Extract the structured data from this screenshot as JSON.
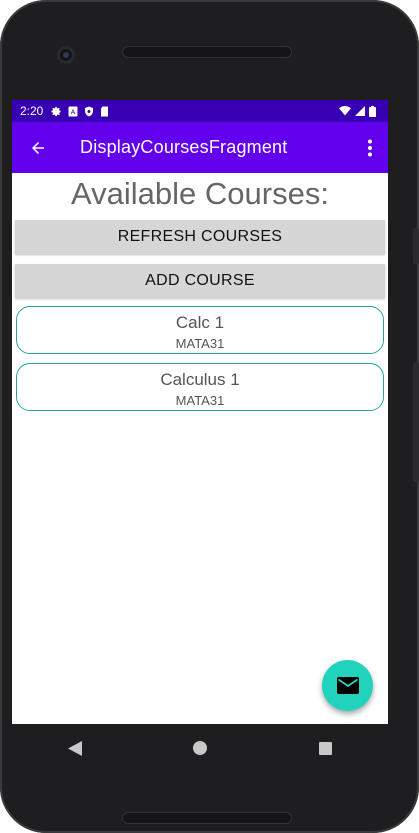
{
  "status_bar": {
    "time": "2:20"
  },
  "app_bar": {
    "title": "DisplayCoursesFragment"
  },
  "content": {
    "heading": "Available Courses:",
    "refresh_button": "REFRESH COURSES",
    "add_button": "ADD COURSE",
    "courses": [
      {
        "name": "Calc 1",
        "code": "MATA31"
      },
      {
        "name": "Calculus 1",
        "code": "MATA31"
      }
    ]
  },
  "colors": {
    "status_bar": "#3700b3",
    "app_bar": "#6200ee",
    "fab": "#21d3bd",
    "card_border": "#26a69a",
    "button_bg": "#d6d6d6"
  },
  "icons": {
    "back": "arrow-back-icon",
    "more": "more-vert-icon",
    "fab": "email-icon",
    "nav_back": "nav-back-icon",
    "nav_home": "nav-home-icon",
    "nav_recents": "nav-recents-icon"
  }
}
